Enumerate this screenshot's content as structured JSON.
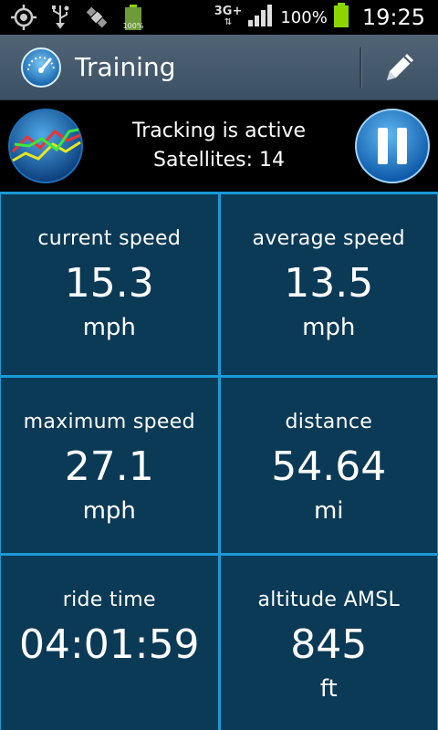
{
  "status_bar": {
    "icons": [
      "gps-target-icon",
      "usb-icon",
      "satellite-icon",
      "battery-full-icon"
    ],
    "battery_overlay": "100%",
    "network": "3G+",
    "battery_percent": "100%",
    "time": "19:25"
  },
  "action_bar": {
    "title": "Training",
    "edit_icon": "pencil-icon"
  },
  "tracking": {
    "status": "Tracking is active",
    "satellites": "Satellites: 14"
  },
  "tiles": [
    {
      "label": "current speed",
      "value": "15.3",
      "unit": "mph"
    },
    {
      "label": "average speed",
      "value": "13.5",
      "unit": "mph"
    },
    {
      "label": "maximum speed",
      "value": "27.1",
      "unit": "mph"
    },
    {
      "label": "distance",
      "value": "54.64",
      "unit": "mi"
    },
    {
      "label": "ride time",
      "value": "04:01:59",
      "unit": ""
    },
    {
      "label": "altitude AMSL",
      "value": "845",
      "unit": "ft"
    }
  ],
  "colors": {
    "tile_bg": "#0b3a56",
    "tile_border": "#1a9ad6",
    "action_bar": "#46596b",
    "battery": "#8cd600"
  }
}
